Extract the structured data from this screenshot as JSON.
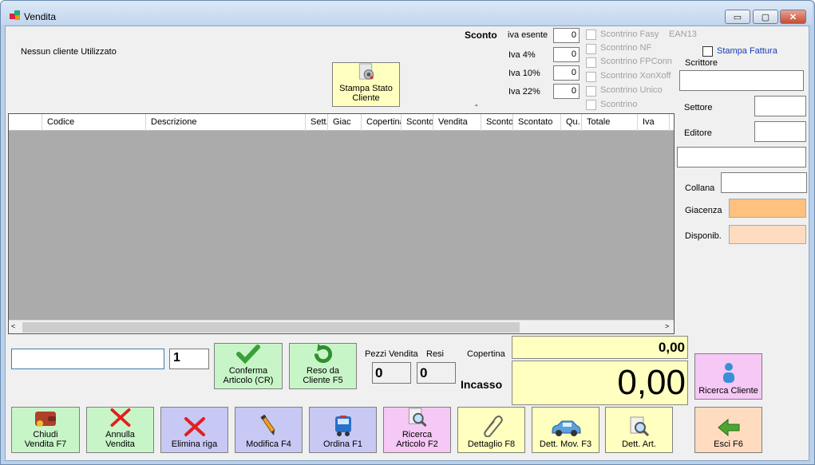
{
  "window": {
    "title": "Vendita",
    "controls": {
      "minimize": "▭",
      "maximize": "▢",
      "close": "✕"
    }
  },
  "customer": {
    "status": "Nessun cliente Utilizzato"
  },
  "print_state_button": "Stampa Stato Cliente",
  "discount": {
    "heading": "Sconto",
    "rows": [
      {
        "label": "iva esente",
        "value": "0"
      },
      {
        "label": "Iva 4%",
        "value": "0"
      },
      {
        "label": "Iva 10%",
        "value": "0"
      },
      {
        "label": "Iva 22%",
        "value": "0"
      }
    ],
    "dash": "-"
  },
  "receipt_options": [
    {
      "label": "Scontrino Fasy",
      "extra": "EAN13"
    },
    {
      "label": "Scontrino NF"
    },
    {
      "label": "Scontrino FPConn"
    },
    {
      "label": "Scontrino XonXoff"
    },
    {
      "label": "Scontrino Unico"
    },
    {
      "label": "Scontrino"
    }
  ],
  "invoice_print": {
    "label": "Stampa Fattura"
  },
  "details": {
    "writer": "Scrittore",
    "sector": "Settore",
    "publisher": "Editore",
    "series": "Collana",
    "stock": "Giacenza",
    "available": "Disponib."
  },
  "table": {
    "columns": [
      "Codice",
      "Descrizione",
      "Sett.",
      "Giac",
      "Copertina",
      "Sconto",
      "Vendita",
      "Sconto",
      "Scontato",
      "Qu.",
      "Totale",
      "Iva"
    ],
    "rows": []
  },
  "entry": {
    "code_value": "",
    "quantity": "1"
  },
  "actions": {
    "confirm": "Conferma Articolo (CR)",
    "return": "Reso da Cliente F5"
  },
  "counters": {
    "pieces_label": "Pezzi Vendita",
    "pieces": "0",
    "returns_label": "Resi",
    "returns": "0"
  },
  "totals": {
    "cover_label": "Copertina",
    "cover_value": "0,00",
    "income_label": "Incasso",
    "income_value": "0,00"
  },
  "search_customer": "Ricerca Cliente",
  "toolbar": [
    {
      "label": "Chiudi Vendita F7",
      "icon": "wallet-icon",
      "color": "#c8f5c8"
    },
    {
      "label": "Annulla Vendita",
      "icon": "red-x-icon",
      "color": "#c8f5c8"
    },
    {
      "label": "Elimina riga",
      "icon": "red-x-icon",
      "color": "#c8c8f5"
    },
    {
      "label": "Modifica F4",
      "icon": "pencil-icon",
      "color": "#c8c8f5"
    },
    {
      "label": "Ordina F1",
      "icon": "bus-icon",
      "color": "#c8c8f5"
    },
    {
      "label": "Ricerca Articolo F2",
      "icon": "magnifier-icon",
      "color": "#f5c8f5"
    },
    {
      "label": "Dettaglio F8",
      "icon": "paperclip-icon",
      "color": "#ffffc0"
    },
    {
      "label": "Dett. Mov. F3",
      "icon": "car-icon",
      "color": "#ffffc0"
    },
    {
      "label": "Dett. Art.",
      "icon": "magnifier-icon",
      "color": "#ffffc0"
    },
    {
      "label": "Esci F6",
      "icon": "arrow-left-icon",
      "color": "#ffdcc0"
    }
  ],
  "colors": {
    "stock_field": "#ffc080",
    "available_field": "#ffdcc0",
    "grid_bg": "#ababab"
  }
}
